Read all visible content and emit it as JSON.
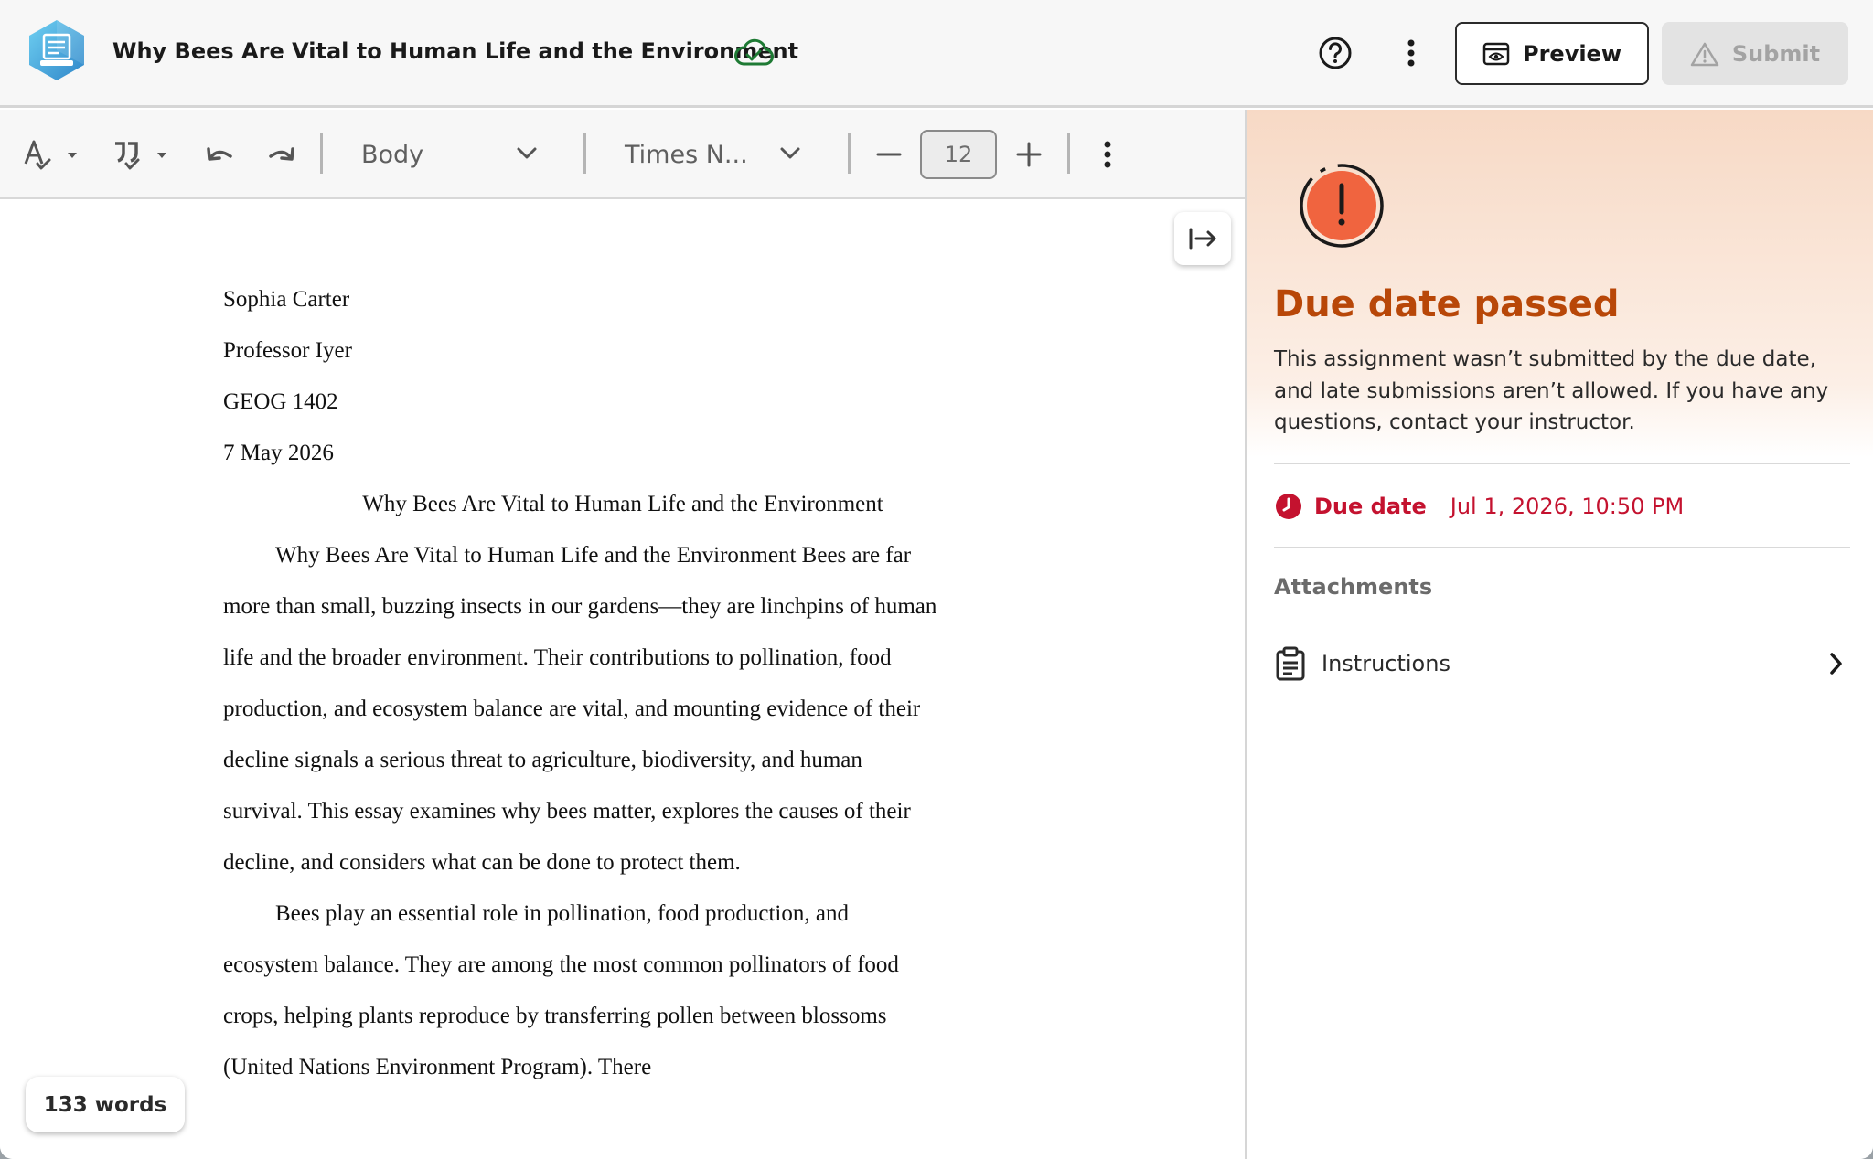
{
  "header": {
    "doc_title": "Why Bees Are Vital to Human Life and the Environment",
    "preview_label": "Preview",
    "submit_label": "Submit"
  },
  "toolbar": {
    "style_value": "Body",
    "font_value": "Times N...",
    "font_size": "12"
  },
  "document": {
    "header_lines": [
      "Sophia Carter",
      "Professor Iyer",
      "GEOG 1402",
      "7 May 2026"
    ],
    "title": "Why Bees Are Vital to Human Life and the Environment",
    "paragraph_1_lines": [
      "Why Bees Are Vital to Human Life and the Environment Bees are far",
      "more than small, buzzing insects in our gardens—they are linchpins of human",
      "life and the broader environment. Their contributions to pollination, food",
      "production, and ecosystem balance are vital, and mounting evidence of their",
      "decline signals a serious threat to agriculture, biodiversity, and human",
      "survival. This essay examines why bees matter, explores the causes of their",
      "decline, and considers what can be done to protect them."
    ],
    "paragraph_2_lines": [
      "Bees play an essential role in pollination, food production, and",
      "ecosystem balance. They are among the most common pollinators of food",
      "crops, helping plants reproduce by transferring pollen between blossoms",
      "(United Nations Environment Program). There"
    ],
    "word_count": "133 words"
  },
  "panel": {
    "title": "Due date passed",
    "message": "This assignment wasn’t submitted by the due date, and late submissions aren’t allowed. If you have any questions, contact your instructor.",
    "due_label": "Due date",
    "due_value": "Jul 1, 2026, 10:50 PM",
    "attachments_title": "Attachments",
    "attachment_name": "Instructions"
  },
  "colors": {
    "alert_orange": "#b84708",
    "due_red": "#c4122f",
    "cloud_green": "#1e7a34"
  },
  "icons": [
    "app-logo-icon",
    "cloud-check-icon",
    "help-icon",
    "more-vertical-icon",
    "eye-icon",
    "warning-icon",
    "text-check-icon",
    "quote-check-icon",
    "undo-icon",
    "redo-icon",
    "chevron-down-icon",
    "minus-icon",
    "plus-icon",
    "collapse-panel-icon",
    "alert-icon",
    "clock-icon",
    "clipboard-icon",
    "chevron-right-icon"
  ]
}
